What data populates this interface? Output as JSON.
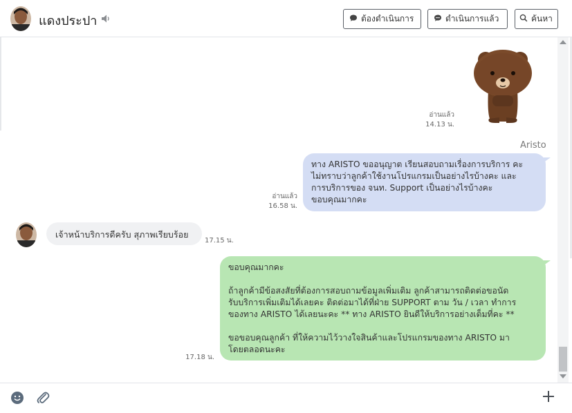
{
  "header": {
    "contact_name": "แดงประปา",
    "btn_todo": "ต้องดำเนินการ",
    "btn_done": "ดำเนินการแล้ว",
    "btn_search": "ค้นหา"
  },
  "messages": {
    "sticker": {
      "status": "อ่านแล้ว",
      "time": "14.13 น."
    },
    "sender_name": "Aristo",
    "out1": {
      "text": "ทาง ARISTO ขออนุญาต เรียนสอบถามเรื่องการบริการ คะ\nไม่ทราบว่าลูกค้าใช้งานโปรแกรมเป็นอย่างไรบ้างคะ และ\nการบริการของ จนท. Support เป็นอย่างไรบ้างคะ\nขอบคุณมากคะ",
      "status": "อ่านแล้ว",
      "time": "16.58 น."
    },
    "in1": {
      "text": "เจ้าหน้าบริการดีครับ สุภาพเรียบร้อย",
      "time": "17.15 น."
    },
    "out2": {
      "text": "ขอบคุณมากคะ\n\nถ้าลูกค้ามีข้อสงสัยที่ต้องการสอบถามข้อมูลเพิ่มเติม ลูกค้าสามารถติดต่อขอนัด\nรับบริการเพิ่มเติมได้เลยคะ ติดต่อมาได้ที่ฝ่าย SUPPORT ตาม วัน / เวลา ทำการ\nของทาง ARISTO ได้เลยนะคะ ** ทาง ARISTO ยินดีให้บริการอย่างเต็มที่คะ **\n\nขอขอบคุณลูกค้า ที่ให้ความไว้วางใจสินค้าและโปรแกรมของทาง ARISTO มา\nโดยตลอดนะคะ",
      "time": "17.18 น."
    }
  },
  "colors": {
    "bubble_blue": "#d4ddf4",
    "bubble_green": "#b8e6b3",
    "bubble_incoming": "#f0f1f3"
  },
  "icons": [
    "user-avatar",
    "speaker-icon",
    "chat-icon",
    "search-icon",
    "bear-sticker",
    "emoji-icon",
    "paperclip-icon",
    "plus-icon"
  ]
}
